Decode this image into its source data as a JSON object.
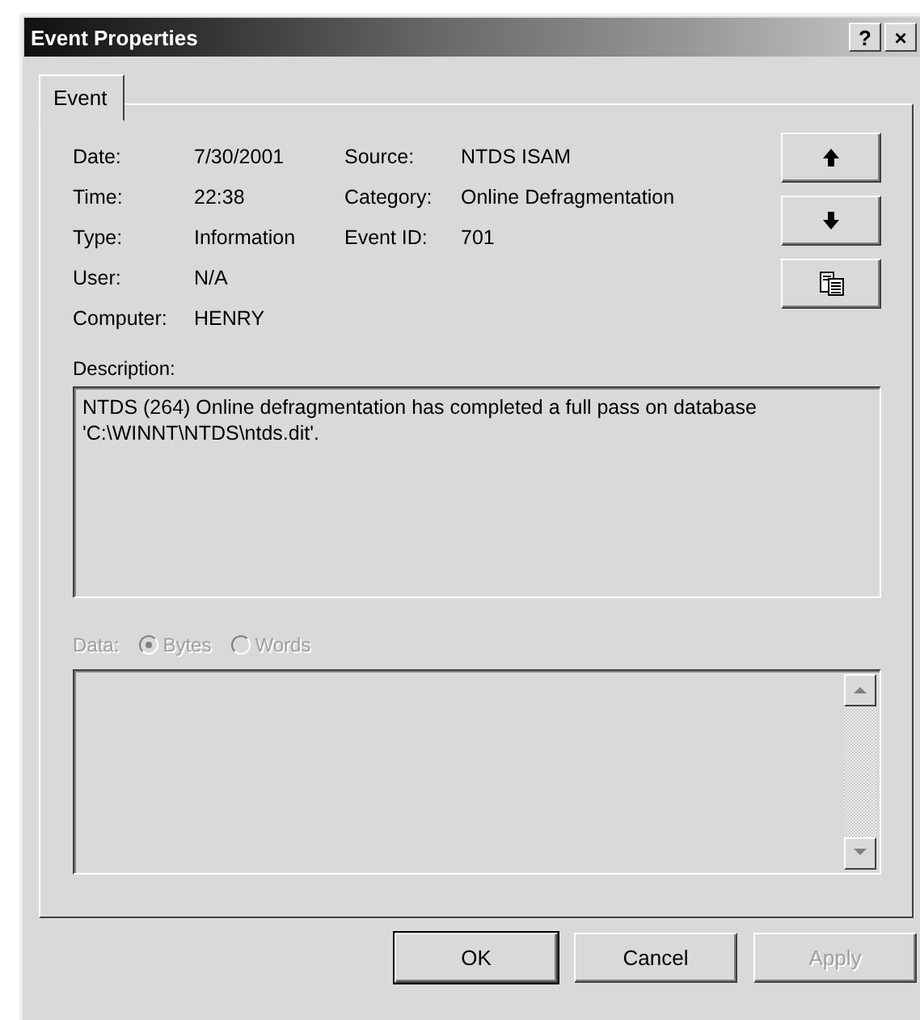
{
  "window": {
    "title": "Event Properties",
    "help_button": "?",
    "close_button": "×"
  },
  "tabs": [
    {
      "label": "Event",
      "selected": true
    }
  ],
  "field_rows": [
    [
      {
        "label": "Date:",
        "value": "7/30/2001"
      },
      {
        "label": "Source:",
        "value": "NTDS ISAM"
      }
    ],
    [
      {
        "label": "Time:",
        "value": "22:38"
      },
      {
        "label": "Category:",
        "value": "Online Defragmentation"
      }
    ],
    [
      {
        "label": "Type:",
        "value": "Information"
      },
      {
        "label": "Event ID:",
        "value": "701"
      }
    ],
    [
      {
        "label": "User:",
        "value": "N/A"
      }
    ],
    [
      {
        "label": "Computer:",
        "value": "HENRY"
      }
    ]
  ],
  "description": {
    "label": "Description:",
    "text": "NTDS (264) Online defragmentation has completed a full pass on database 'C:\\WINNT\\NTDS\\ntds.dit'."
  },
  "data": {
    "label": "Data:",
    "disabled": true,
    "options": [
      {
        "label": "Bytes",
        "selected": true
      },
      {
        "label": "Words",
        "selected": false
      }
    ]
  },
  "buttons": [
    {
      "label": "OK",
      "default": true,
      "disabled": false
    },
    {
      "label": "Cancel",
      "default": false,
      "disabled": false
    },
    {
      "label": "Apply",
      "default": false,
      "disabled": true
    }
  ]
}
